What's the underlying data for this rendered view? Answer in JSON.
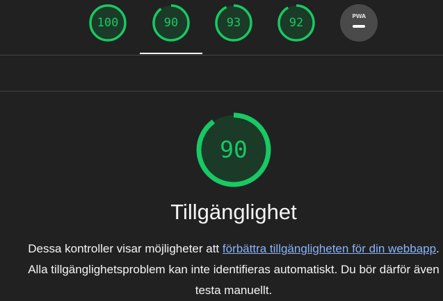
{
  "tabs": [
    {
      "score": "100",
      "progress": 1.0
    },
    {
      "score": "90",
      "progress": 0.9
    },
    {
      "score": "93",
      "progress": 0.93
    },
    {
      "score": "92",
      "progress": 0.92
    }
  ],
  "active_tab_index": 1,
  "pwa_tab": {
    "label": "PWA",
    "icon": "dash-icon"
  },
  "category": {
    "score": "90",
    "progress": 0.9,
    "title": "Tillgänglighet",
    "description_before": "Dessa kontroller visar möjligheter att ",
    "link_text": "förbättra tillgängligheten för din webbapp",
    "description_after": ". Alla tillgänglighetsproblem kan inte identifieras automatiskt. Du bör därför även testa manuellt."
  },
  "colors": {
    "background": "#212121",
    "pass_green": "#18c964",
    "pass_fill": "#1c3a28",
    "link": "#8ab4f8"
  }
}
